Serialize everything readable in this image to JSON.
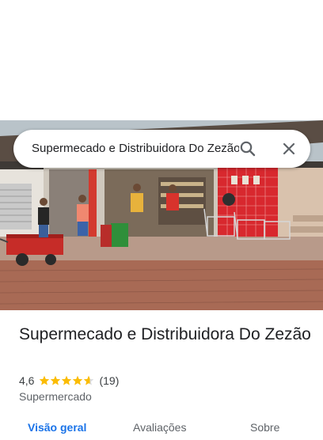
{
  "search": {
    "query": "Supermecado e Distribuidora Do Zezão"
  },
  "place": {
    "name": "Supermecado e Distribuidora Do Zezão",
    "rating_text": "4,6",
    "rating_value": 4.6,
    "review_count": "(19)",
    "category": "Supermercado"
  },
  "tabs": [
    {
      "label": "Visão geral",
      "active": true
    },
    {
      "label": "Avaliações",
      "active": false
    },
    {
      "label": "Sobre",
      "active": false
    }
  ],
  "colors": {
    "accent": "#1a73e8",
    "star": "#fbbc04",
    "tile_red": "#d8282e"
  }
}
